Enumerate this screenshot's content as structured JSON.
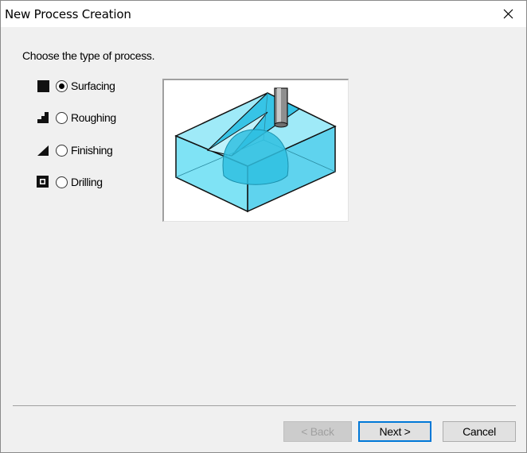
{
  "window": {
    "title": "New Process Creation"
  },
  "dialog": {
    "prompt": "Choose the type of process.",
    "options": [
      {
        "label": "Surfacing",
        "icon": "square-icon",
        "selected": true
      },
      {
        "label": "Roughing",
        "icon": "steps-icon",
        "selected": false
      },
      {
        "label": "Finishing",
        "icon": "slope-icon",
        "selected": false
      },
      {
        "label": "Drilling",
        "icon": "hole-icon",
        "selected": false
      }
    ],
    "preview": "surfacing-illustration"
  },
  "buttons": {
    "back": "< Back",
    "next": "Next >",
    "cancel": "Cancel"
  },
  "colors": {
    "accent": "#0078d7",
    "preview_fill": "#7fe3f5",
    "preview_dark": "#3ec7e6"
  }
}
